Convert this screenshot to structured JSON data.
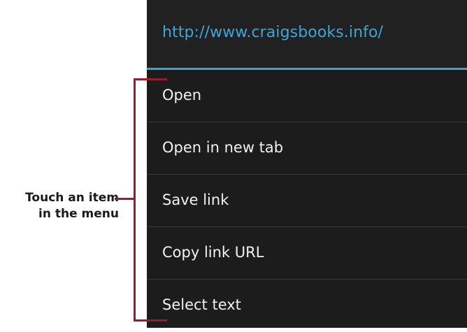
{
  "menu": {
    "url": "http://www.craigsbooks.info/",
    "items": [
      {
        "label": "Open"
      },
      {
        "label": "Open in new tab"
      },
      {
        "label": "Save link"
      },
      {
        "label": "Copy link URL"
      },
      {
        "label": "Select text"
      }
    ]
  },
  "callout": {
    "line1": "Touch an item",
    "line2": "in the menu"
  },
  "colors": {
    "accent": "#3fa4d6",
    "background": "#1c1c1c",
    "header_background": "#212121",
    "text": "#f2f2f2",
    "divider": "#3a3a3a",
    "callout": "#9b1b2b"
  }
}
